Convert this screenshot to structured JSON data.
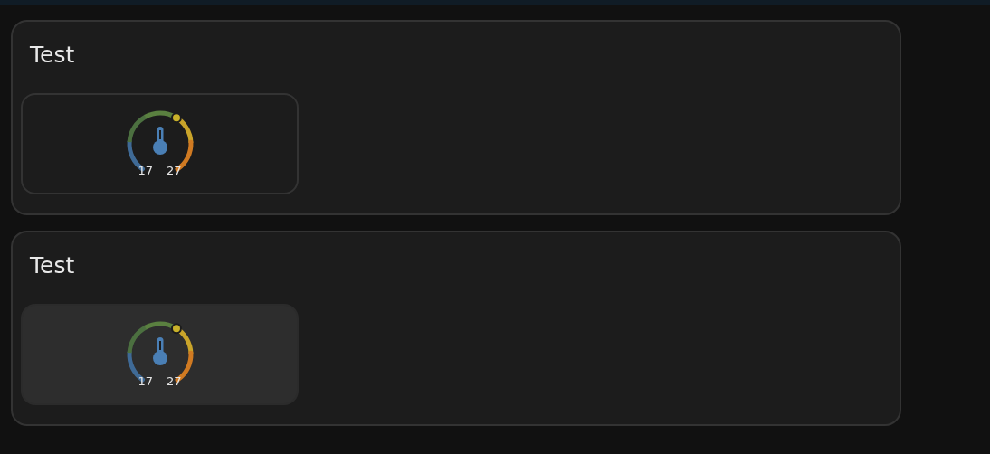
{
  "cards": [
    {
      "title": "Test",
      "tile": {
        "kind": "outlined",
        "min": "17",
        "max": "27"
      }
    },
    {
      "title": "Test",
      "tile": {
        "kind": "filled",
        "min": "17",
        "max": "27"
      }
    }
  ]
}
